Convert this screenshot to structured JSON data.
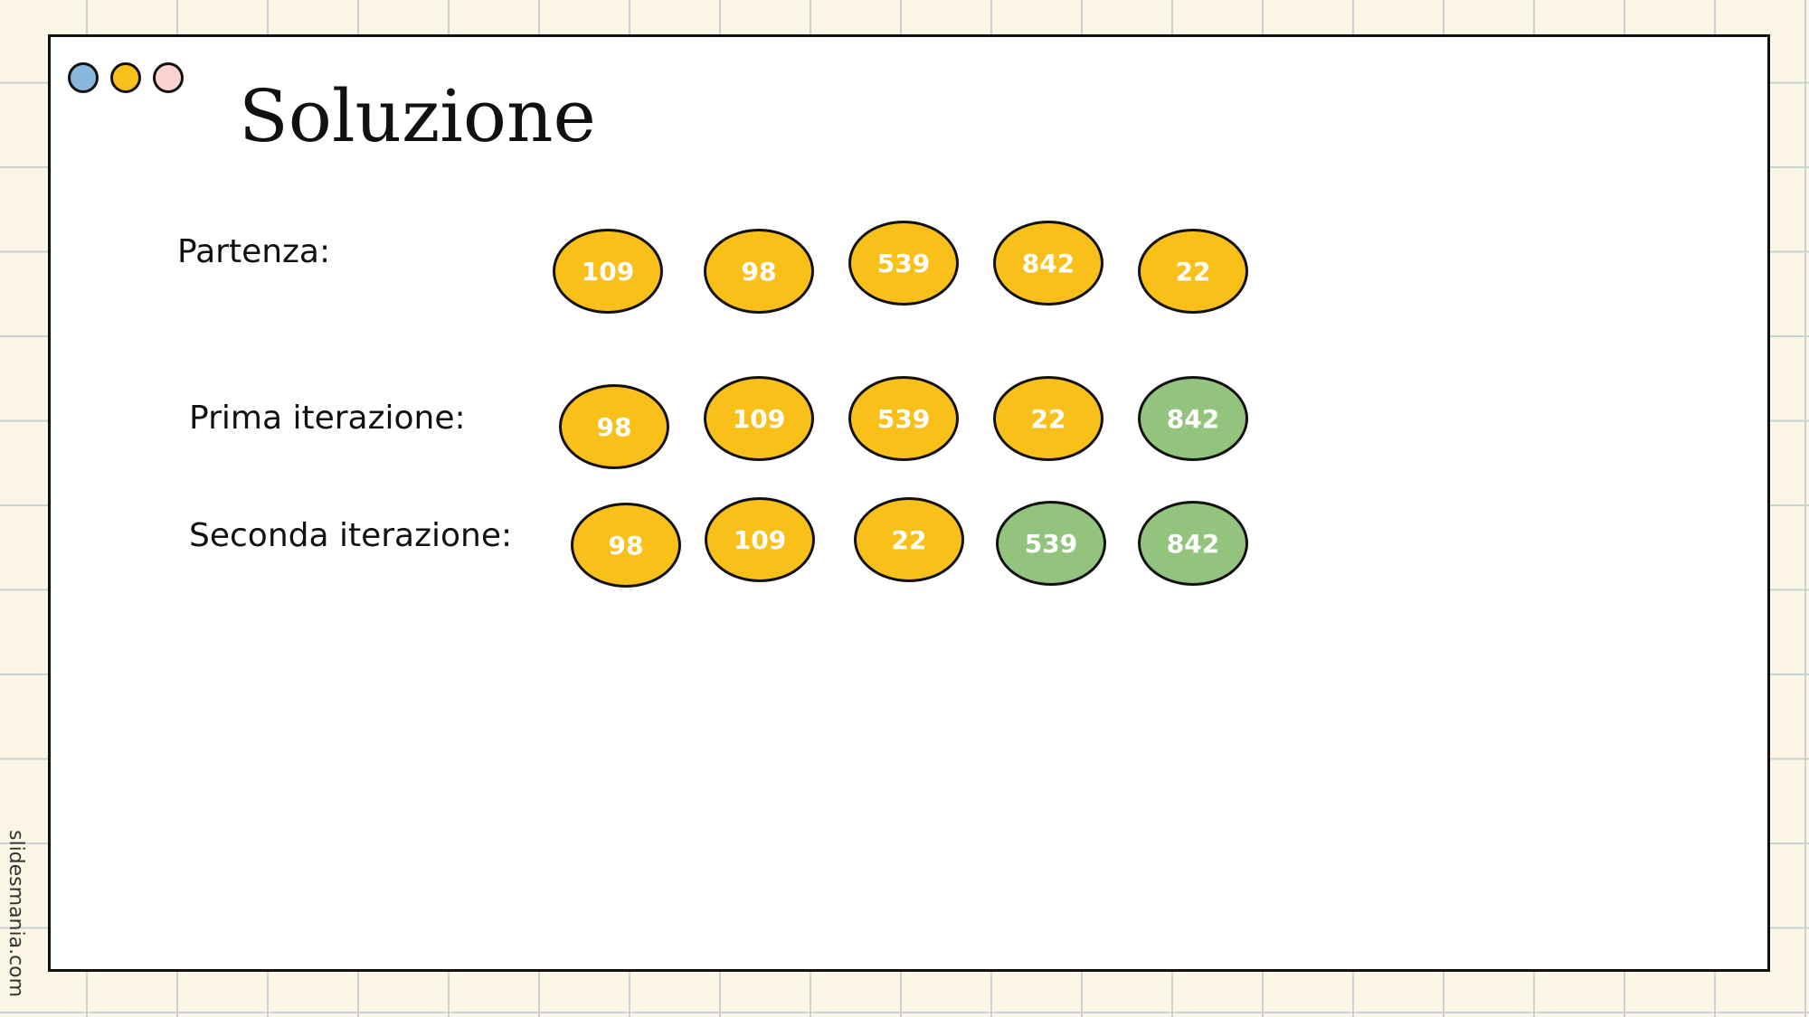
{
  "title": "Soluzione",
  "watermark": "slidesmania.com",
  "colors": {
    "unsorted": "#f9c01a",
    "sorted": "#93c47d",
    "dot_blue": "#8bb6de",
    "dot_yellow": "#f9c01a",
    "dot_pink": "#fbd3cf"
  },
  "rows": [
    {
      "label": "Partenza:",
      "nodes": [
        {
          "value": "109",
          "state": "unsorted"
        },
        {
          "value": "98",
          "state": "unsorted"
        },
        {
          "value": "539",
          "state": "unsorted"
        },
        {
          "value": "842",
          "state": "unsorted"
        },
        {
          "value": "22",
          "state": "unsorted"
        }
      ]
    },
    {
      "label": "Prima iterazione:",
      "nodes": [
        {
          "value": "98",
          "state": "unsorted"
        },
        {
          "value": "109",
          "state": "unsorted"
        },
        {
          "value": "539",
          "state": "unsorted"
        },
        {
          "value": "22",
          "state": "unsorted"
        },
        {
          "value": "842",
          "state": "sorted"
        }
      ]
    },
    {
      "label": "Seconda iterazione:",
      "nodes": [
        {
          "value": "98",
          "state": "unsorted"
        },
        {
          "value": "109",
          "state": "unsorted"
        },
        {
          "value": "22",
          "state": "unsorted"
        },
        {
          "value": "539",
          "state": "sorted"
        },
        {
          "value": "842",
          "state": "sorted"
        }
      ]
    }
  ]
}
